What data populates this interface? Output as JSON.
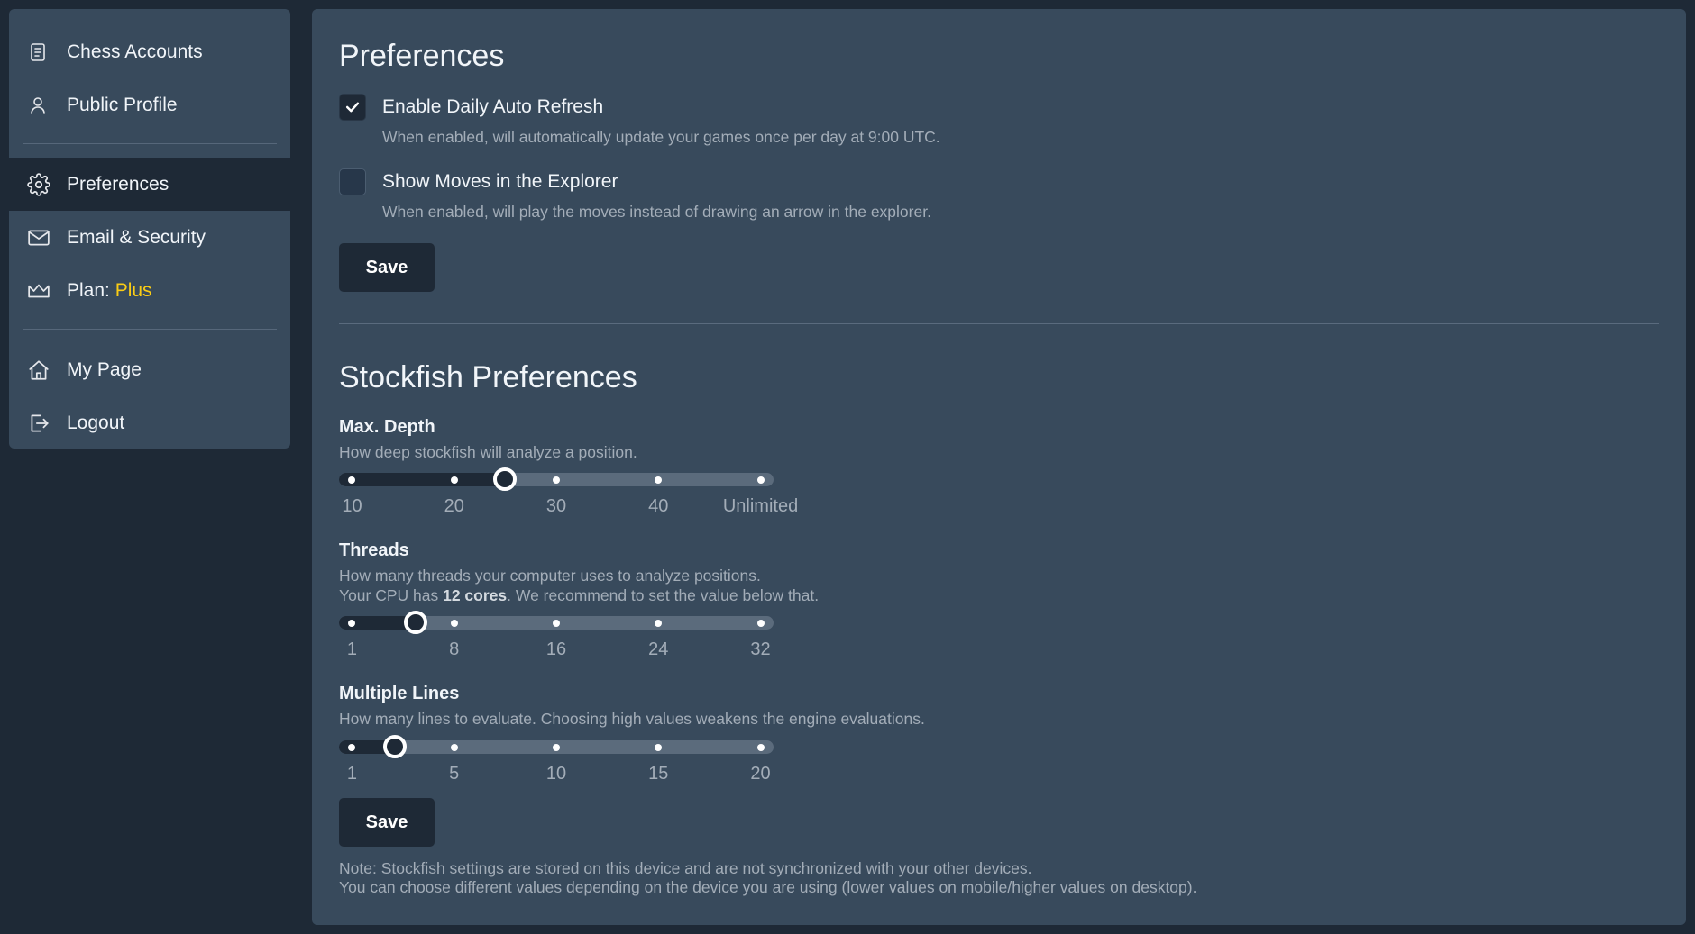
{
  "sidebar": {
    "items": [
      {
        "label": "Chess Accounts",
        "icon": "document-icon"
      },
      {
        "label": "Public Profile",
        "icon": "user-icon"
      },
      {
        "label": "Preferences",
        "icon": "gear-icon",
        "active": true
      },
      {
        "label": "Email & Security",
        "icon": "mail-icon"
      },
      {
        "label": "Plan: ",
        "highlight": "Plus",
        "icon": "crown-icon"
      },
      {
        "label": "My Page",
        "icon": "home-icon"
      },
      {
        "label": "Logout",
        "icon": "logout-icon"
      }
    ],
    "plan_color": "#facc15"
  },
  "preferences": {
    "title": "Preferences",
    "options": [
      {
        "label": "Enable Daily Auto Refresh",
        "checked": true,
        "description": "When enabled, will automatically update your games once per day at 9:00 UTC."
      },
      {
        "label": "Show Moves in the Explorer",
        "checked": false,
        "description": "When enabled, will play the moves instead of drawing an arrow in the explorer."
      }
    ],
    "save_label": "Save"
  },
  "stockfish": {
    "title": "Stockfish Preferences",
    "sliders": [
      {
        "label": "Max. Depth",
        "description": [
          "How deep stockfish will analyze a position."
        ],
        "ticks": [
          "10",
          "20",
          "30",
          "40",
          "Unlimited"
        ],
        "value_fraction": 0.375
      },
      {
        "label": "Threads",
        "description_line1": "How many threads your computer uses to analyze positions.",
        "description_line2_pre": "Your CPU has ",
        "description_line2_bold": "12 cores",
        "description_line2_post": ". We recommend to set the value below that.",
        "ticks": [
          "1",
          "8",
          "16",
          "24",
          "32"
        ],
        "value": 6,
        "value_fraction": 0.156
      },
      {
        "label": "Multiple Lines",
        "description": [
          "How many lines to evaluate. Choosing high values weakens the engine evaluations."
        ],
        "ticks": [
          "1",
          "5",
          "10",
          "15",
          "20"
        ],
        "value": 3,
        "value_fraction": 0.105
      }
    ],
    "save_label": "Save",
    "note_line1": "Note: Stockfish settings are stored on this device and are not synchronized with your other devices.",
    "note_line2": "You can choose different values depending on the device you are using (lower values on mobile/higher values on desktop)."
  }
}
